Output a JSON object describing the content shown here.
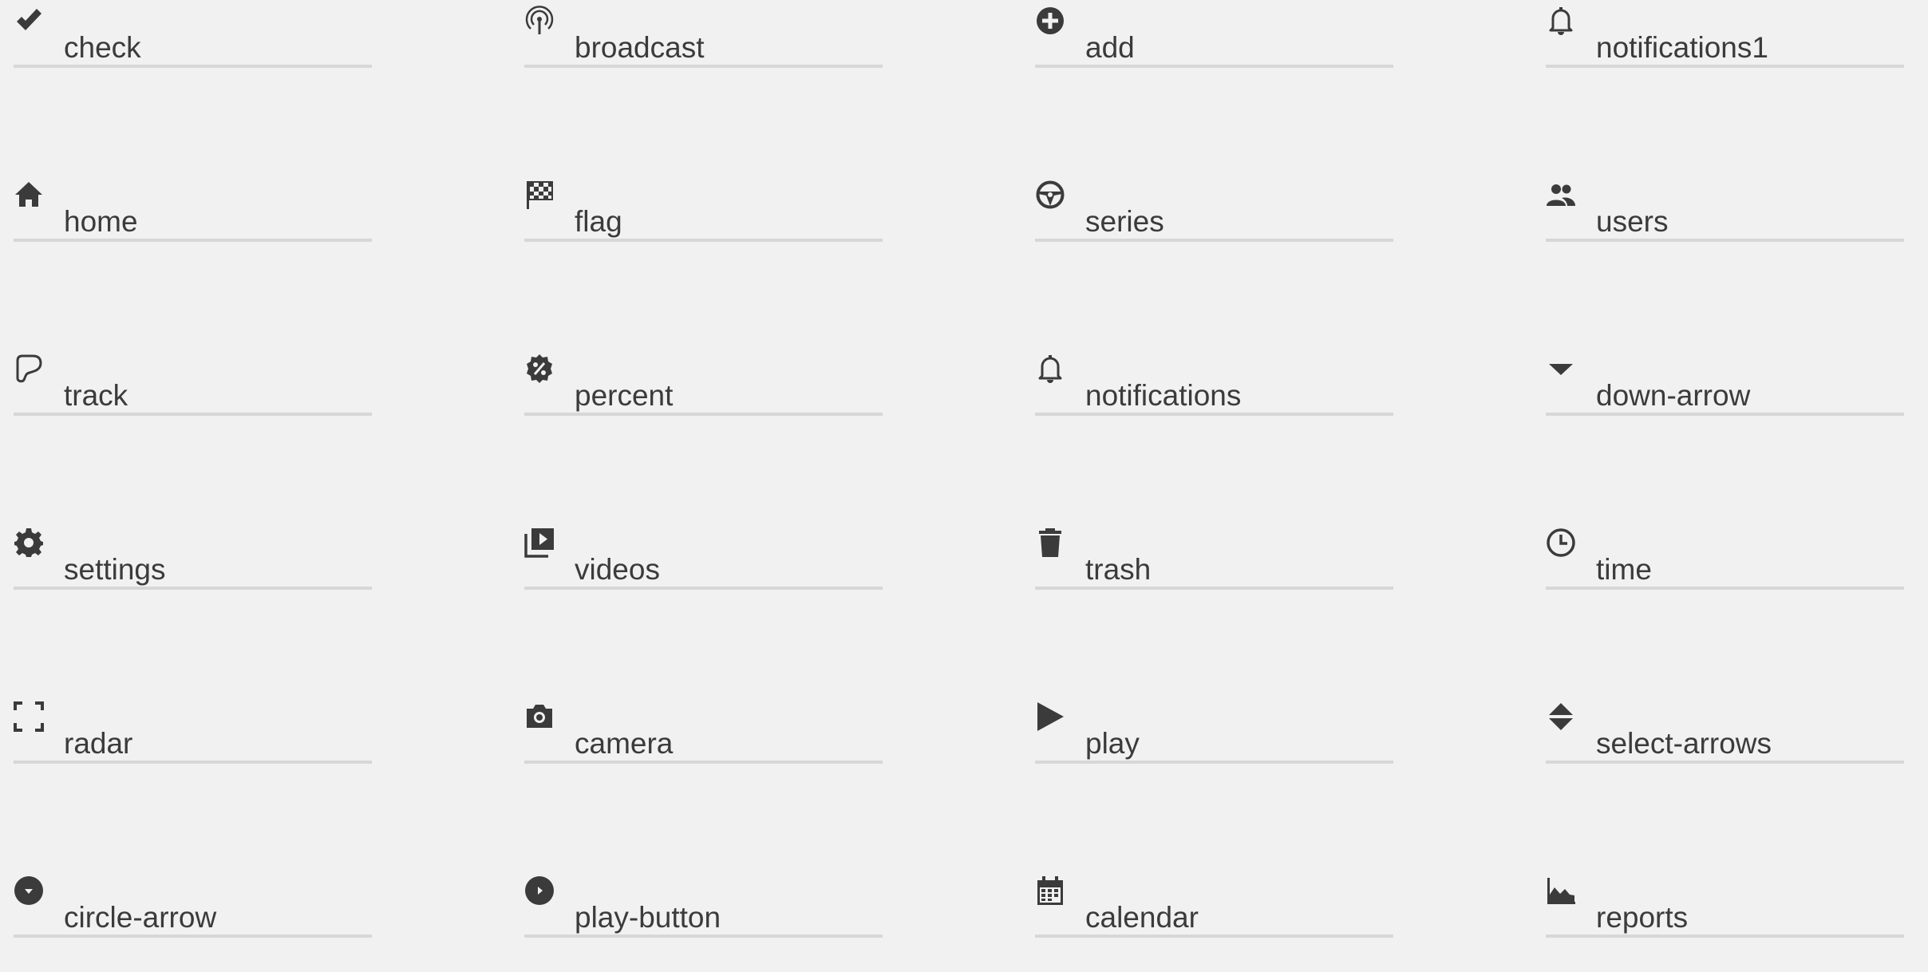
{
  "icon_color": "#3b3b3b",
  "underline_color": "#d7d7d7",
  "background_color": "#f1f1f1",
  "items": [
    {
      "label": "check",
      "icon": "check-icon"
    },
    {
      "label": "broadcast",
      "icon": "broadcast-icon"
    },
    {
      "label": "add",
      "icon": "add-icon"
    },
    {
      "label": "notifications1",
      "icon": "notifications1-icon"
    },
    {
      "label": "home",
      "icon": "home-icon"
    },
    {
      "label": "flag",
      "icon": "flag-icon"
    },
    {
      "label": "series",
      "icon": "series-icon"
    },
    {
      "label": "users",
      "icon": "users-icon"
    },
    {
      "label": "track",
      "icon": "track-icon"
    },
    {
      "label": "percent",
      "icon": "percent-icon"
    },
    {
      "label": "notifications",
      "icon": "notifications-icon"
    },
    {
      "label": "down-arrow",
      "icon": "down-arrow-icon"
    },
    {
      "label": "settings",
      "icon": "settings-icon"
    },
    {
      "label": "videos",
      "icon": "videos-icon"
    },
    {
      "label": "trash",
      "icon": "trash-icon"
    },
    {
      "label": "time",
      "icon": "time-icon"
    },
    {
      "label": "radar",
      "icon": "radar-icon"
    },
    {
      "label": "camera",
      "icon": "camera-icon"
    },
    {
      "label": "play",
      "icon": "play-icon"
    },
    {
      "label": "select-arrows",
      "icon": "select-arrows-icon"
    },
    {
      "label": "circle-arrow",
      "icon": "circle-arrow-icon"
    },
    {
      "label": "play-button",
      "icon": "play-button-icon"
    },
    {
      "label": "calendar",
      "icon": "calendar-icon"
    },
    {
      "label": "reports",
      "icon": "reports-icon"
    }
  ]
}
